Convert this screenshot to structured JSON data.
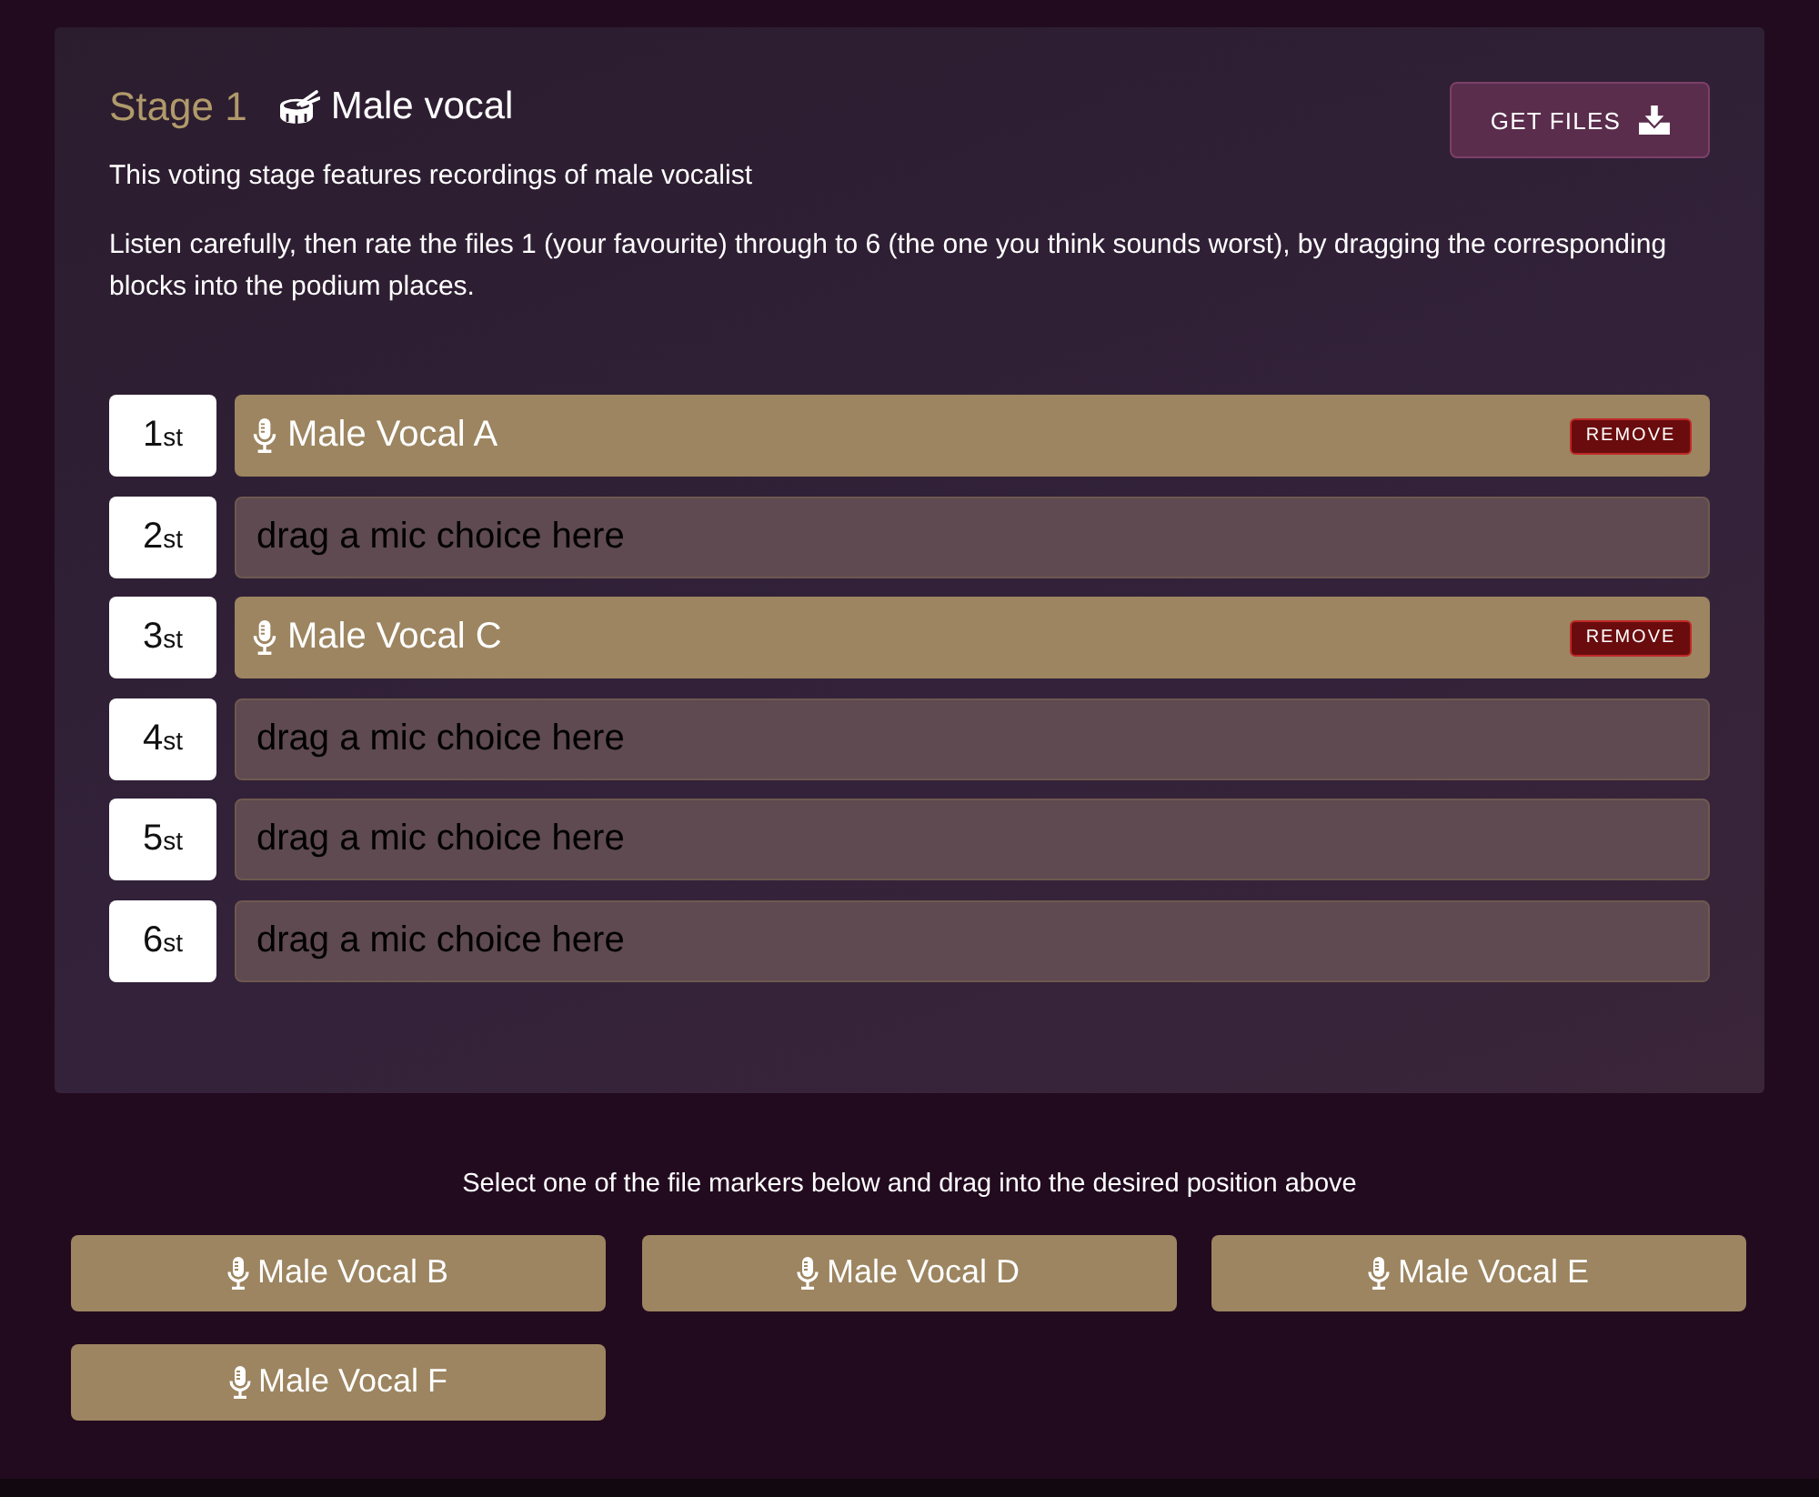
{
  "stage": {
    "label": "Stage 1",
    "title": "Male vocal",
    "button": "GET FILES"
  },
  "description": "This voting stage features recordings of male vocalist",
  "instructions": "Listen carefully, then rate the files 1 (your favourite) through to 6 (the one you think sounds worst), by dragging the corresponding blocks into the podium places.",
  "podium": [
    {
      "number": "1",
      "suffix": "st",
      "slot": {
        "kind": "filled",
        "label": "Male Vocal A",
        "action": "REMOVE"
      }
    },
    {
      "number": "2",
      "suffix": "st",
      "slot": {
        "kind": "empty",
        "hint": "drag a mic choice here"
      }
    },
    {
      "number": "3",
      "suffix": "st",
      "slot": {
        "kind": "filled",
        "label": "Male Vocal C",
        "action": "REMOVE"
      }
    },
    {
      "number": "4",
      "suffix": "st",
      "slot": {
        "kind": "empty",
        "hint": "drag a mic choice here"
      }
    },
    {
      "number": "5",
      "suffix": "st",
      "slot": {
        "kind": "empty",
        "hint": "drag a mic choice here"
      }
    },
    {
      "number": "6",
      "suffix": "st",
      "slot": {
        "kind": "empty",
        "hint": "drag a mic choice here"
      }
    }
  ],
  "choices_prompt": "Select one of the file markers below and drag into the desired position above",
  "choices": [
    "Male Vocal B",
    "Male Vocal D",
    "Male Vocal E",
    "Male Vocal F"
  ]
}
